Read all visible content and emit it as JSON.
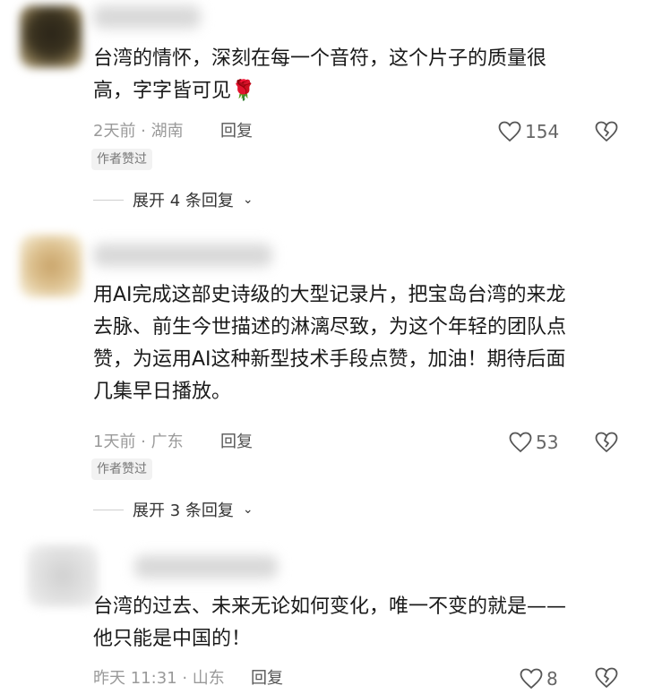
{
  "comments": [
    {
      "text": "台湾的情怀，深刻在每一个音符，这个片子的质量很\n高，字字皆可见",
      "emoji": "🌹",
      "time_location": "2天前 · 湖南",
      "reply_label": "回复",
      "likes": "154",
      "badge": "作者赞过",
      "expand_label": "展开 4 条回复"
    },
    {
      "text": "用AI完成这部史诗级的大型记录片，把宝岛台湾的来龙\n去脉、前生今世描述的淋漓尽致，为这个年轻的团队点\n赞，为运用AI这种新型技术手段点赞，加油！期待后面\n几集早日播放。",
      "time_location": "1天前 · 广东",
      "reply_label": "回复",
      "likes": "53",
      "badge": "作者赞过",
      "expand_label": "展开 3 条回复"
    },
    {
      "text": "台湾的过去、未来无论如何变化，唯一不变的就是——\n他只能是中国的！",
      "time_location": "昨天 11:31 · 山东",
      "reply_label": "回复",
      "likes": "8"
    }
  ],
  "icons": {
    "like": "heart-outline-icon",
    "dislike": "broken-heart-icon",
    "expand": "chevron-down-icon",
    "rose": "rose-emoji"
  },
  "colors": {
    "meta_text": "#9a9a9a",
    "body_text": "#1a1a1a",
    "badge_bg": "#f2f2f2"
  }
}
